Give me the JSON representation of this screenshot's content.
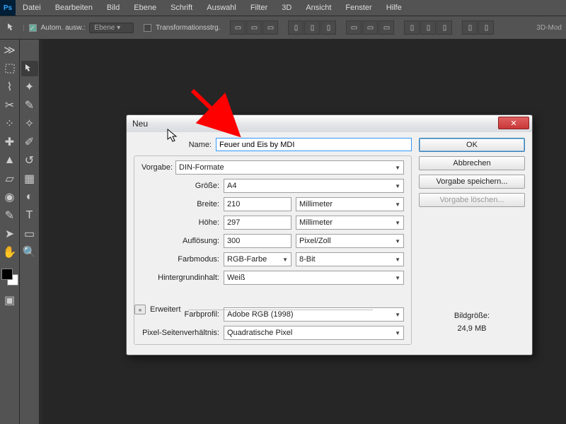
{
  "app": {
    "logo": "Ps"
  },
  "menu": [
    "Datei",
    "Bearbeiten",
    "Bild",
    "Ebene",
    "Schrift",
    "Auswahl",
    "Filter",
    "3D",
    "Ansicht",
    "Fenster",
    "Hilfe"
  ],
  "options": {
    "auto_label": "Autom. ausw.:",
    "layer_select": "Ebene",
    "transform_label": "Transformationsstrg.",
    "mode3d": "3D-Mod"
  },
  "dialog": {
    "title": "Neu",
    "name_label": "Name:",
    "name_value": "Feuer und Eis by MDI",
    "preset_label": "Vorgabe:",
    "preset_value": "DIN-Formate",
    "size_label": "Größe:",
    "size_value": "A4",
    "width_label": "Breite:",
    "width_value": "210",
    "width_unit": "Millimeter",
    "height_label": "Höhe:",
    "height_value": "297",
    "height_unit": "Millimeter",
    "res_label": "Auflösung:",
    "res_value": "300",
    "res_unit": "Pixel/Zoll",
    "mode_label": "Farbmodus:",
    "mode_value": "RGB-Farbe",
    "depth_value": "8-Bit",
    "bg_label": "Hintergrundinhalt:",
    "bg_value": "Weiß",
    "advanced_label": "Erweitert",
    "profile_label": "Farbprofil:",
    "profile_value": "Adobe RGB (1998)",
    "aspect_label": "Pixel-Seitenverhältnis:",
    "aspect_value": "Quadratische Pixel",
    "ok": "OK",
    "cancel": "Abbrechen",
    "save_preset": "Vorgabe speichern...",
    "delete_preset": "Vorgabe löschen...",
    "img_size_label": "Bildgröße:",
    "img_size_value": "24,9 MB"
  }
}
